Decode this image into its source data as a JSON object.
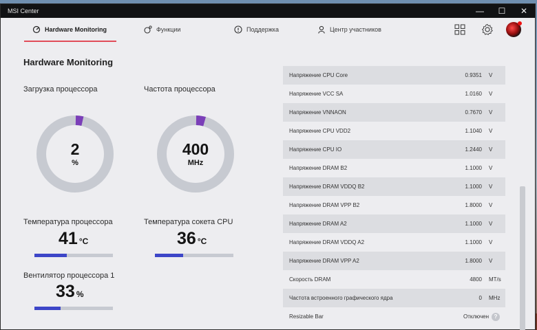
{
  "window": {
    "title": "MSI Center",
    "controls": [
      "—",
      "☐",
      "✕"
    ]
  },
  "nav": {
    "tabs": [
      {
        "label": "Hardware Monitoring",
        "icon": "monitor-icon",
        "active": true
      },
      {
        "label": "Функции",
        "icon": "features-icon",
        "active": false
      },
      {
        "label": "Поддержка",
        "icon": "support-icon",
        "active": false
      },
      {
        "label": "Центр участников",
        "icon": "member-icon",
        "active": false
      }
    ],
    "right_icons": [
      "grid-icon",
      "gear-icon",
      "avatar"
    ]
  },
  "monitor": {
    "title": "Hardware Monitoring",
    "cpu_load": {
      "label": "Загрузка процессора",
      "value": "2",
      "unit": "%",
      "fraction": 0.02
    },
    "cpu_freq": {
      "label": "Частота процессора",
      "value": "400",
      "unit": "MHz",
      "fraction": 0.04
    },
    "cpu_temp": {
      "label": "Температура процессора",
      "value": "41",
      "unit": "°C",
      "fraction": 0.41
    },
    "socket_temp": {
      "label": "Температура сокета CPU",
      "value": "36",
      "unit": "°C",
      "fraction": 0.36
    },
    "cpu_fan": {
      "label": "Вентилятор процессора 1",
      "value": "33",
      "unit": "%",
      "fraction": 0.33
    }
  },
  "accent": {
    "gauge": "#7b3fb8",
    "track": "#c7cad1",
    "bar": "#3d46c8",
    "tab_underline": "#e14b58"
  },
  "readings": [
    {
      "name": "Напряжение CPU Core",
      "value": "0.9351",
      "unit": "V"
    },
    {
      "name": "Напряжение VCC SA",
      "value": "1.0160",
      "unit": "V"
    },
    {
      "name": "Напряжение VNNAON",
      "value": "0.7670",
      "unit": "V"
    },
    {
      "name": "Напряжение CPU VDD2",
      "value": "1.1040",
      "unit": "V"
    },
    {
      "name": "Напряжение CPU IO",
      "value": "1.2440",
      "unit": "V"
    },
    {
      "name": "Напряжение DRAM B2",
      "value": "1.1000",
      "unit": "V"
    },
    {
      "name": "Напряжение DRAM VDDQ B2",
      "value": "1.1000",
      "unit": "V"
    },
    {
      "name": "Напряжение DRAM VPP B2",
      "value": "1.8000",
      "unit": "V"
    },
    {
      "name": "Напряжение DRAM A2",
      "value": "1.1000",
      "unit": "V"
    },
    {
      "name": "Напряжение DRAM VDDQ A2",
      "value": "1.1000",
      "unit": "V"
    },
    {
      "name": "Напряжение DRAM VPP A2",
      "value": "1.8000",
      "unit": "V"
    },
    {
      "name": "Скорость DRAM",
      "value": "4800",
      "unit": "MT/s"
    },
    {
      "name": "Частота встроенного графического ядра",
      "value": "0",
      "unit": "MHz"
    }
  ],
  "resizable_bar": {
    "name": "Resizable Bar",
    "status": "Отключен",
    "help": "?"
  }
}
